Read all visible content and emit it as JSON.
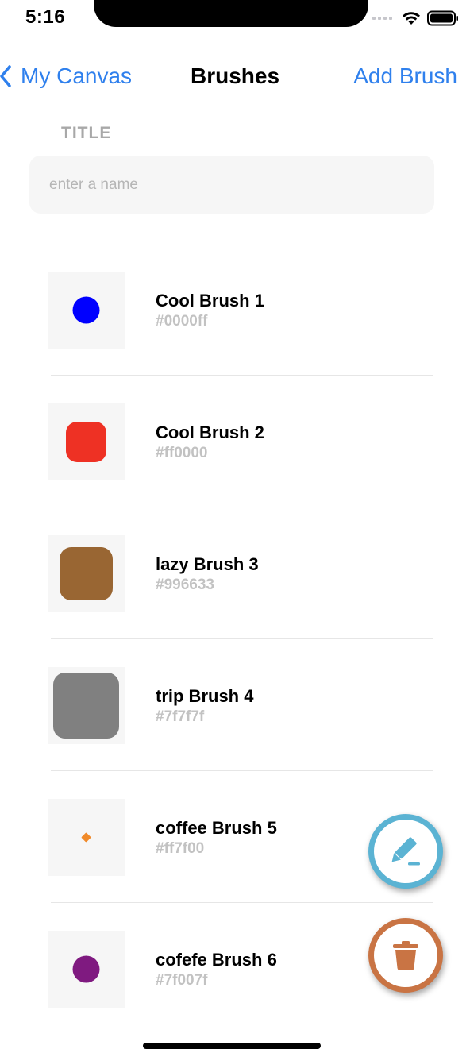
{
  "status_bar": {
    "time": "5:16"
  },
  "nav": {
    "back_label": "My Canvas",
    "title": "Brushes",
    "add_label": "Add Brush"
  },
  "form": {
    "title_label": "TITLE",
    "name_placeholder": "enter a name",
    "name_value": ""
  },
  "brushes": [
    {
      "name": "Cool Brush 1",
      "hex": "#0000ff",
      "color": "#0000ff",
      "shape": "circle"
    },
    {
      "name": "Cool Brush 2",
      "hex": "#ff0000",
      "color": "#ee3124",
      "shape": "rounded-square"
    },
    {
      "name": "lazy Brush 3",
      "hex": "#996633",
      "color": "#996633",
      "shape": "rounded-square"
    },
    {
      "name": "trip Brush 4",
      "hex": "#7f7f7f",
      "color": "#808080",
      "shape": "rounded-square"
    },
    {
      "name": "coffee Brush 5",
      "hex": "#ff7f00",
      "color": "#f08a2a",
      "shape": "diamond"
    },
    {
      "name": "cofefe Brush 6",
      "hex": "#7f007f",
      "color": "#7f1a80",
      "shape": "circle"
    }
  ],
  "fabs": {
    "edit_icon": "pencil-icon",
    "edit_color": "#5bb3d3",
    "delete_icon": "trash-icon",
    "delete_color": "#c97444"
  },
  "colors": {
    "accent": "#2f80ed"
  }
}
